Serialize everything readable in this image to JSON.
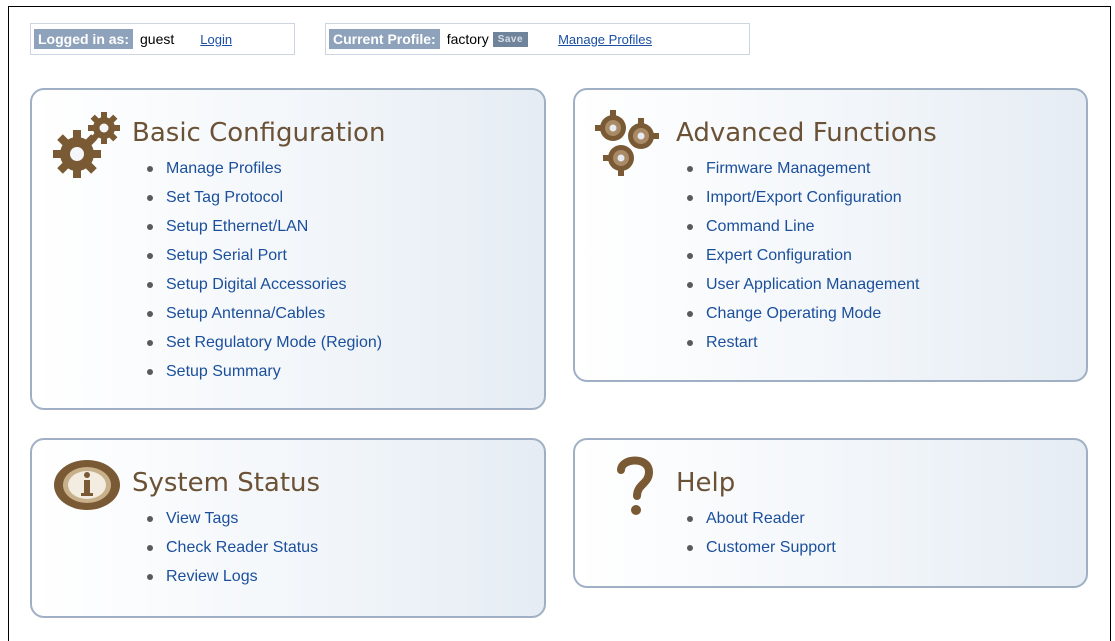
{
  "header": {
    "logged_in_label": "Logged in as:",
    "user": "guest",
    "login_link": "Login",
    "profile_label": "Current Profile:",
    "profile": "factory",
    "save_button": "Save",
    "manage_profiles_link": "Manage Profiles"
  },
  "panels": {
    "basic": {
      "title": "Basic Configuration",
      "icon": "gears-icon",
      "items": [
        "Manage Profiles",
        "Set Tag Protocol",
        "Setup Ethernet/LAN",
        "Setup Serial Port",
        "Setup Digital Accessories",
        "Setup Antenna/Cables",
        "Set Regulatory Mode (Region)",
        "Setup Summary"
      ]
    },
    "advanced": {
      "title": "Advanced Functions",
      "icon": "gears-cluster-icon",
      "items": [
        "Firmware Management",
        "Import/Export Configuration",
        "Command Line",
        "Expert Configuration",
        "User Application Management",
        "Change Operating Mode",
        "Restart"
      ]
    },
    "status": {
      "title": "System Status",
      "icon": "info-icon",
      "items": [
        "View Tags",
        "Check Reader Status",
        "Review Logs"
      ]
    },
    "help": {
      "title": "Help",
      "icon": "question-mark-icon",
      "items": [
        "About Reader",
        "Customer Support"
      ]
    }
  },
  "colors": {
    "title": "#6b5236",
    "link": "#1b4f9b",
    "panel_border": "#9fb0c5",
    "tag_bg": "#8ea2bb",
    "icon": "#7a5a34"
  }
}
